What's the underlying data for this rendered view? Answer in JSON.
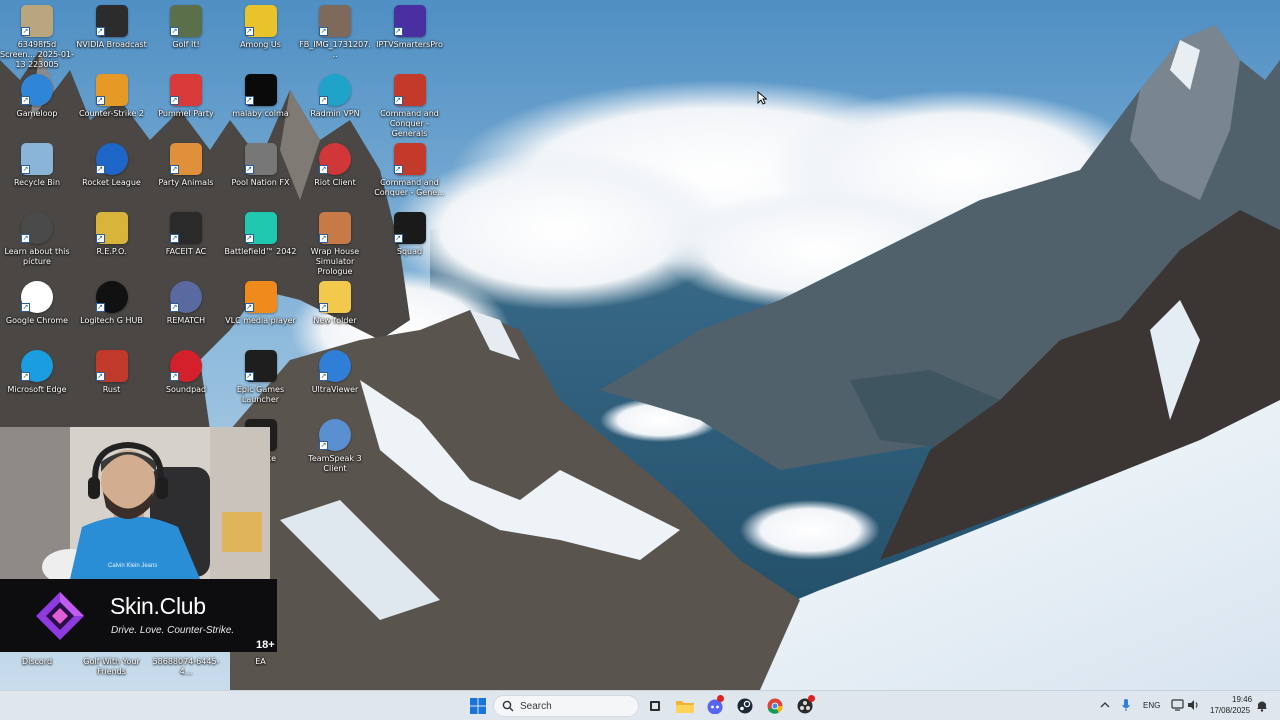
{
  "desktop": {
    "icons": [
      {
        "label": "63498f5d Screen... 2025-01-13 223005",
        "icon": "photo-thumbnail-icon",
        "color": "#b9a57e",
        "col": 0,
        "row": 0
      },
      {
        "label": "NVIDIA Broadcast",
        "icon": "nvidia-broadcast-icon",
        "color": "#2c2c2c",
        "col": 1,
        "row": 0
      },
      {
        "label": "Golf It!",
        "icon": "golf-it-icon",
        "color": "#5a6f4a",
        "col": 2,
        "row": 0
      },
      {
        "label": "Among Us",
        "icon": "among-us-icon",
        "color": "#e8c42a",
        "col": 3,
        "row": 0
      },
      {
        "label": "FB_IMG_1731207...",
        "icon": "photo-thumbnail-icon",
        "color": "#7d6a5a",
        "col": 4,
        "row": 0
      },
      {
        "label": "IPTVSmartersPro",
        "icon": "iptv-icon",
        "color": "#4a2fa0",
        "col": 5,
        "row": 0
      },
      {
        "label": "Gameloop",
        "icon": "gameloop-icon",
        "color": "#2f86d6",
        "col": 0,
        "row": 1
      },
      {
        "label": "Counter-Strike 2",
        "icon": "counter-strike-icon",
        "color": "#e59a26",
        "col": 1,
        "row": 1
      },
      {
        "label": "Pummel Party",
        "icon": "pummel-party-icon",
        "color": "#d83a3a",
        "col": 2,
        "row": 1
      },
      {
        "label": "malaby colma",
        "icon": "black-file-icon",
        "color": "#0a0a0a",
        "col": 3,
        "row": 1
      },
      {
        "label": "Radmin VPN",
        "icon": "radmin-vpn-icon",
        "color": "#1fa3c9",
        "col": 4,
        "row": 1
      },
      {
        "label": "Command and Conquer - Generals",
        "icon": "command-conquer-icon",
        "color": "#c33a2a",
        "col": 5,
        "row": 1
      },
      {
        "label": "Recycle Bin",
        "icon": "recycle-bin-icon",
        "color": "#8ab4d8",
        "col": 0,
        "row": 2
      },
      {
        "label": "Rocket League",
        "icon": "rocket-league-icon",
        "color": "#1f66c9",
        "col": 1,
        "row": 2
      },
      {
        "label": "Party Animals",
        "icon": "party-animals-icon",
        "color": "#e0903a",
        "col": 2,
        "row": 2
      },
      {
        "label": "Pool Nation FX",
        "icon": "pool-nation-icon",
        "color": "#777777",
        "col": 3,
        "row": 2
      },
      {
        "label": "Riot Client",
        "icon": "riot-client-icon",
        "color": "#d13639",
        "col": 4,
        "row": 2
      },
      {
        "label": "Command and Conquer - Gene...",
        "icon": "command-conquer-icon",
        "color": "#c33a2a",
        "col": 5,
        "row": 2
      },
      {
        "label": "Learn about this picture",
        "icon": "learn-about-picture-icon",
        "color": "#4a4a4a",
        "col": 0,
        "row": 3
      },
      {
        "label": "R.E.P.O.",
        "icon": "repo-icon",
        "color": "#d8b43a",
        "col": 1,
        "row": 3
      },
      {
        "label": "FACEIT AC",
        "icon": "faceit-icon",
        "color": "#2a2a2a",
        "col": 2,
        "row": 3
      },
      {
        "label": "Battlefield™ 2042",
        "icon": "battlefield-icon",
        "color": "#1ec9b0",
        "col": 3,
        "row": 3
      },
      {
        "label": "Wrap House Simulator Prologue",
        "icon": "wrap-house-icon",
        "color": "#c77a45",
        "col": 4,
        "row": 3
      },
      {
        "label": "Squad",
        "icon": "squad-icon",
        "color": "#1a1a1a",
        "col": 5,
        "row": 3
      },
      {
        "label": "Google Chrome",
        "icon": "chrome-icon",
        "color": "#ffffff",
        "col": 0,
        "row": 4
      },
      {
        "label": "Logitech G HUB",
        "icon": "logitech-ghub-icon",
        "color": "#111111",
        "col": 1,
        "row": 4
      },
      {
        "label": "REMATCH",
        "icon": "rematch-icon",
        "color": "#5a6aa0",
        "col": 2,
        "row": 4
      },
      {
        "label": "VLC media player",
        "icon": "vlc-icon",
        "color": "#f08a1c",
        "col": 3,
        "row": 4
      },
      {
        "label": "New folder",
        "icon": "folder-icon",
        "color": "#f2c94c",
        "col": 4,
        "row": 4
      },
      {
        "label": "Microsoft Edge",
        "icon": "edge-icon",
        "color": "#1b9de2",
        "col": 0,
        "row": 5
      },
      {
        "label": "Rust",
        "icon": "rust-icon",
        "color": "#c0392b",
        "col": 1,
        "row": 5
      },
      {
        "label": "Soundpad",
        "icon": "soundpad-icon",
        "color": "#d4202a",
        "col": 2,
        "row": 5
      },
      {
        "label": "Epic Games Launcher",
        "icon": "epic-games-icon",
        "color": "#1e1e1e",
        "col": 3,
        "row": 5
      },
      {
        "label": "UltraViewer",
        "icon": "ultraviewer-icon",
        "color": "#2f7fd6",
        "col": 4,
        "row": 5
      },
      {
        "label": "Fortnite",
        "icon": "epic-games-icon",
        "color": "#1e1e1e",
        "col": 3,
        "row": 6
      },
      {
        "label": "TeamSpeak 3 Client",
        "icon": "teamspeak-icon",
        "color": "#5a8fd0",
        "col": 4,
        "row": 6
      }
    ],
    "bottom_icons": [
      {
        "label": "Discord",
        "icon": "discord-icon",
        "col": 0
      },
      {
        "label": "Golf With Your Friends",
        "icon": "golf-with-friends-icon",
        "col": 1
      },
      {
        "label": "58688074-6445-4...",
        "icon": "file-icon",
        "col": 2
      },
      {
        "label": "EA",
        "icon": "ea-icon",
        "col": 3
      }
    ]
  },
  "overlay": {
    "brand": "Skin.Club",
    "tagline": "Drive. Love. Counter-Strike.",
    "age_rating": "18+",
    "shirt_text": "Calvin Klein Jeans"
  },
  "taskbar": {
    "search_placeholder": "Search",
    "apps": [
      "start-icon",
      "task-view-icon",
      "file-explorer-icon",
      "discord-icon",
      "steam-icon",
      "chrome-icon",
      "obs-icon"
    ],
    "language": "ENG",
    "time": "19:46",
    "date": "17/08/2025"
  }
}
